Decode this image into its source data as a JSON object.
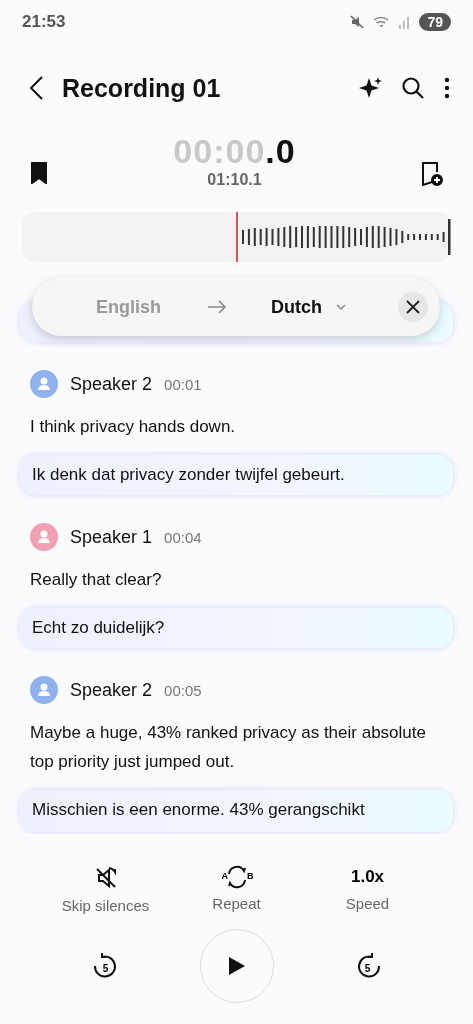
{
  "status_bar": {
    "time": "21:53",
    "battery": "79"
  },
  "header": {
    "title": "Recording 01"
  },
  "player": {
    "position_main": "00:00",
    "position_tenths": ".0",
    "duration": "01:10.1",
    "bookmarked": true
  },
  "translation_bar": {
    "from": "English",
    "to": "Dutch"
  },
  "transcript": [
    {
      "speaker": "Speaker 2",
      "time": "00:01",
      "color": "#8fb1ee",
      "text": "I think privacy hands down.",
      "translation": "Ik denk dat privacy zonder twijfel gebeurt."
    },
    {
      "speaker": "Speaker 1",
      "time": "00:04",
      "color": "#f2a0b4",
      "text": "Really that clear?",
      "translation": "Echt zo duidelijk?"
    },
    {
      "speaker": "Speaker 2",
      "time": "00:05",
      "color": "#8fb1ee",
      "text": "Maybe a huge, 43% ranked privacy as their absolute top priority just jumped out.",
      "translation": "Misschien is een enorme. 43% gerangschikt"
    }
  ],
  "controls": [
    {
      "kind": "skip",
      "label": "Skip silences"
    },
    {
      "kind": "repeat",
      "label": "Repeat",
      "marks": [
        "A",
        "B"
      ]
    },
    {
      "kind": "speed",
      "label": "Speed",
      "value": "1.0x"
    }
  ],
  "transport": {
    "rewind": "5",
    "forward": "5"
  }
}
